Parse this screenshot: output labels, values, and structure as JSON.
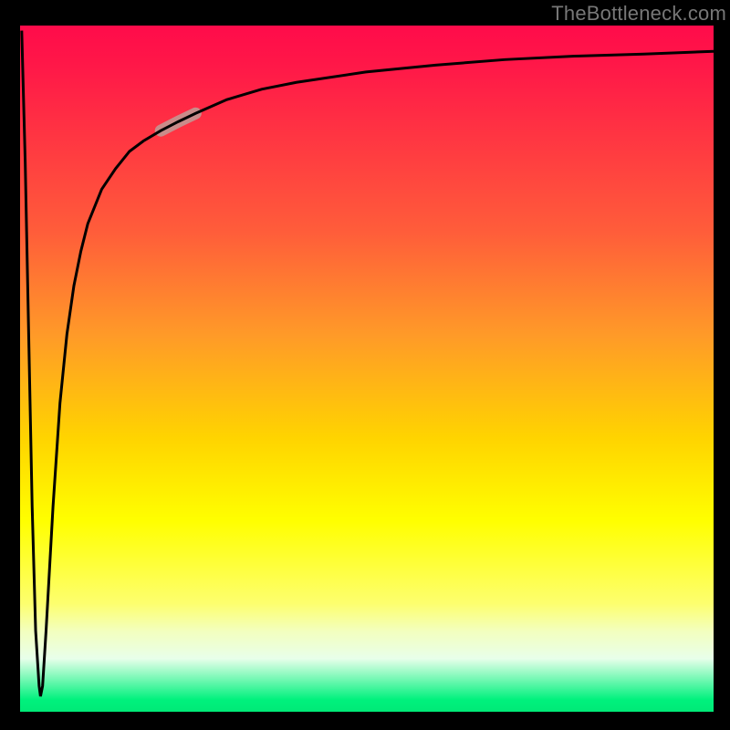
{
  "attribution": "TheBottleneck.com",
  "colors": {
    "gradient_top": "#ff0b4a",
    "gradient_mid1": "#ff9a28",
    "gradient_mid2": "#ffff00",
    "gradient_bottom": "#00e876",
    "curve": "#000000",
    "highlight": "#c98c8a",
    "background": "#000000"
  },
  "chart_data": {
    "type": "line",
    "title": "",
    "xlabel": "",
    "ylabel": "",
    "xlim": [
      0,
      100
    ],
    "ylim": [
      0,
      100
    ],
    "legend": false,
    "grid": false,
    "series": [
      {
        "name": "bottleneck-curve",
        "x": [
          0.5,
          1.0,
          1.5,
          2.0,
          2.5,
          3.0,
          3.2,
          3.5,
          4.0,
          5.0,
          6.0,
          7.0,
          8.0,
          9.0,
          10.0,
          12.0,
          14.0,
          16.0,
          18.0,
          20.5,
          23.0,
          25.5,
          30.0,
          35.0,
          40.0,
          50.0,
          60.0,
          70.0,
          80.0,
          90.0,
          100.0
        ],
        "y": [
          99.0,
          80.0,
          55.0,
          30.0,
          12.0,
          4.0,
          2.5,
          4.0,
          12.0,
          30.0,
          45.0,
          55.0,
          62.0,
          67.0,
          71.0,
          76.0,
          79.0,
          81.5,
          83.0,
          84.5,
          85.8,
          87.0,
          89.0,
          90.5,
          91.5,
          93.0,
          94.0,
          94.8,
          95.3,
          95.6,
          96.0
        ]
      }
    ],
    "highlight_segment": {
      "x_start": 20.5,
      "x_end": 25.5
    },
    "annotations": []
  }
}
